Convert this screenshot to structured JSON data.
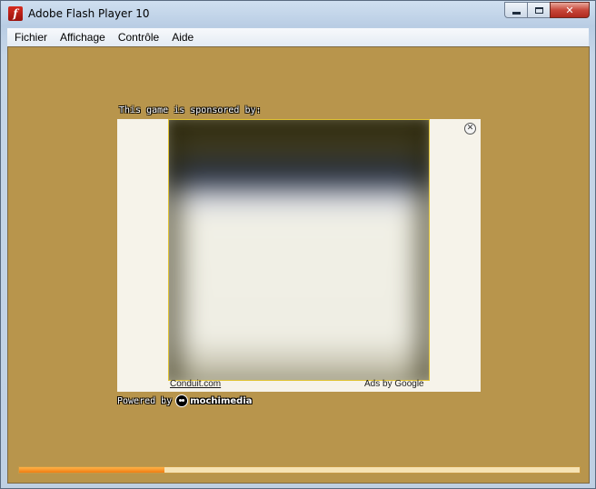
{
  "window": {
    "title": "Adobe Flash Player 10",
    "app_icon_glyph": "f",
    "controls": {
      "minimize": "minimize-icon",
      "maximize": "maximize-icon",
      "close": "close-icon",
      "close_glyph": "✕"
    }
  },
  "menubar": {
    "items": [
      {
        "label": "Fichier"
      },
      {
        "label": "Affichage"
      },
      {
        "label": "Contrôle"
      },
      {
        "label": "Aide"
      }
    ]
  },
  "stage": {
    "background": "#b8954c",
    "sponsor_label": "This game is sponsored by:",
    "ad": {
      "close_glyph": "✕",
      "link_text": "Conduit.com",
      "ads_by": "Ads by Google"
    },
    "powered_by": {
      "label": "Powered by",
      "brand": "mochimedia"
    },
    "progress": {
      "value": 0.26,
      "fill_color": "#f07d12",
      "track_color": "#f6e3b4"
    }
  }
}
